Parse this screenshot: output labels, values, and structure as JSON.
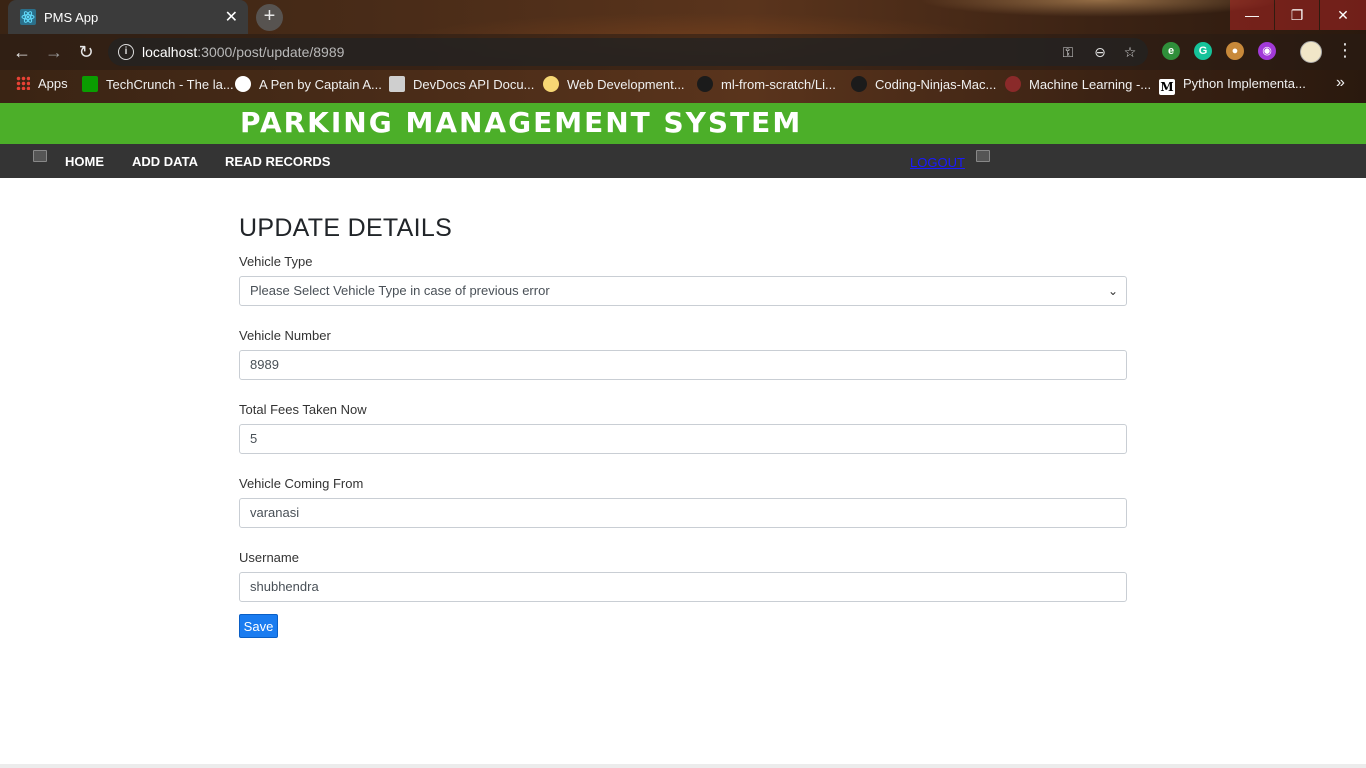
{
  "browser": {
    "tab_title": "PMS App",
    "tab_close": "✕",
    "new_tab": "+",
    "window": {
      "minimize": "—",
      "maximize": "❐",
      "close": "✕"
    },
    "url_host": "localhost",
    "url_rest": ":3000/post/update/8989",
    "bookmarks": [
      {
        "label": "Apps"
      },
      {
        "label": "TechCrunch - The la..."
      },
      {
        "label": "A Pen by Captain A..."
      },
      {
        "label": "DevDocs API Docu..."
      },
      {
        "label": "Web Development..."
      },
      {
        "label": "ml-from-scratch/Li..."
      },
      {
        "label": "Coding-Ninjas-Mac..."
      },
      {
        "label": "Machine Learning -..."
      },
      {
        "label": "Python Implementa..."
      }
    ],
    "bookmarks_more": "»"
  },
  "app": {
    "banner_title": "PARKING MANAGEMENT SYSTEM",
    "nav": {
      "home": "HOME",
      "add_data": "ADD DATA",
      "read_records": "READ RECORDS",
      "logout": "LOGOUT"
    },
    "form": {
      "heading": "UPDATE DETAILS",
      "vehicle_type_label": "Vehicle Type",
      "vehicle_type_value": "Please Select Vehicle Type in case of previous error",
      "vehicle_number_label": "Vehicle Number",
      "vehicle_number_value": "8989",
      "fees_label": "Total Fees Taken Now",
      "fees_value": "5",
      "coming_from_label": "Vehicle Coming From",
      "coming_from_value": "varanasi",
      "username_label": "Username",
      "username_value": "shubhendra",
      "save_label": "Save"
    }
  },
  "colors": {
    "banner": "#4caf29",
    "navbar": "#343434",
    "button": "#1a7cf0",
    "logout_link": "#1a1aff"
  }
}
